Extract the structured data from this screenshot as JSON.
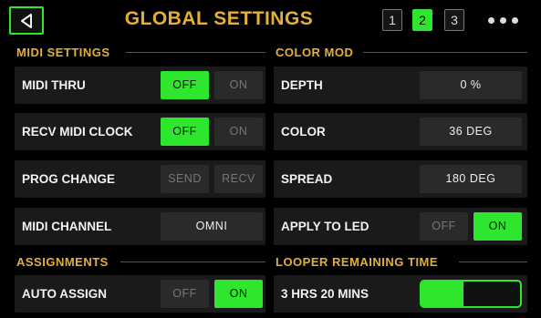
{
  "header": {
    "title": "GLOBAL SETTINGS",
    "pages": [
      "1",
      "2",
      "3"
    ],
    "active_page": "2",
    "back_icon": "back-triangle-icon",
    "more_icon": "more-dots-icon"
  },
  "colors": {
    "accent_green": "#2fe62f",
    "title_gold": "#e3b037",
    "row_bg": "#1a1a1a",
    "button_bg": "#2a2a2a"
  },
  "midi_settings": {
    "heading": "MIDI SETTINGS",
    "midi_thru": {
      "label": "MIDI THRU",
      "options": [
        "OFF",
        "ON"
      ],
      "selected": "OFF"
    },
    "recv_midi_clock": {
      "label": "RECV MIDI CLOCK",
      "options": [
        "OFF",
        "ON"
      ],
      "selected": "OFF"
    },
    "prog_change": {
      "label": "PROG CHANGE",
      "options": [
        "SEND",
        "RECV"
      ],
      "selected": ""
    },
    "midi_channel": {
      "label": "MIDI CHANNEL",
      "value": "OMNI"
    }
  },
  "color_mod": {
    "heading": "COLOR MOD",
    "depth": {
      "label": "DEPTH",
      "value": "0 %"
    },
    "color": {
      "label": "COLOR",
      "value": "36 DEG"
    },
    "spread": {
      "label": "SPREAD",
      "value": "180 DEG"
    },
    "apply_to_led": {
      "label": "APPLY TO LED",
      "options": [
        "OFF",
        "ON"
      ],
      "selected": "ON"
    }
  },
  "assignments": {
    "heading": "ASSIGNMENTS",
    "auto_assign": {
      "label": "AUTO ASSIGN",
      "options": [
        "OFF",
        "ON"
      ],
      "selected": "ON"
    }
  },
  "looper": {
    "heading": "LOOPER REMAINING TIME",
    "remaining_label": "3 HRS 20 MINS",
    "remaining_fraction": 0.43
  }
}
